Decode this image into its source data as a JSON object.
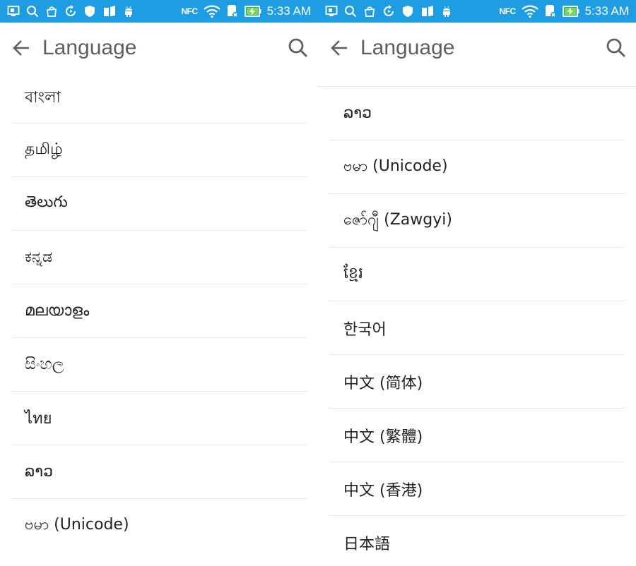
{
  "colors": {
    "status_bar": "#1e9de3",
    "divider": "#e7e7e7",
    "title_text": "#5f5f5f"
  },
  "status_bar": {
    "time": "5:33 AM",
    "nfc_label": "NFC",
    "icons": [
      "screenshot-icon",
      "search-icon",
      "bag-icon",
      "sync-icon",
      "shield-icon",
      "weather-icon",
      "android-icon",
      "nfc-icon",
      "wifi-icon",
      "sd-card-icon",
      "battery-charging-icon"
    ]
  },
  "screens": [
    {
      "title": "Language",
      "items": [
        "বাংলা",
        "தமிழ்",
        "తెలుగు",
        "ಕನ್ನಡ",
        "മലയാളം",
        "සිංහල",
        "ไทย",
        "ລາວ",
        "ဗမာ (Unicode)"
      ]
    },
    {
      "title": "Language",
      "items": [
        "ລາວ",
        "ဗမာ (Unicode)",
        "ဇော်ဂျီ (Zawgyi)",
        "ខ្មែរ",
        "한국어",
        "中文 (简体)",
        "中文 (繁體)",
        "中文 (香港)",
        "日本語"
      ]
    }
  ]
}
